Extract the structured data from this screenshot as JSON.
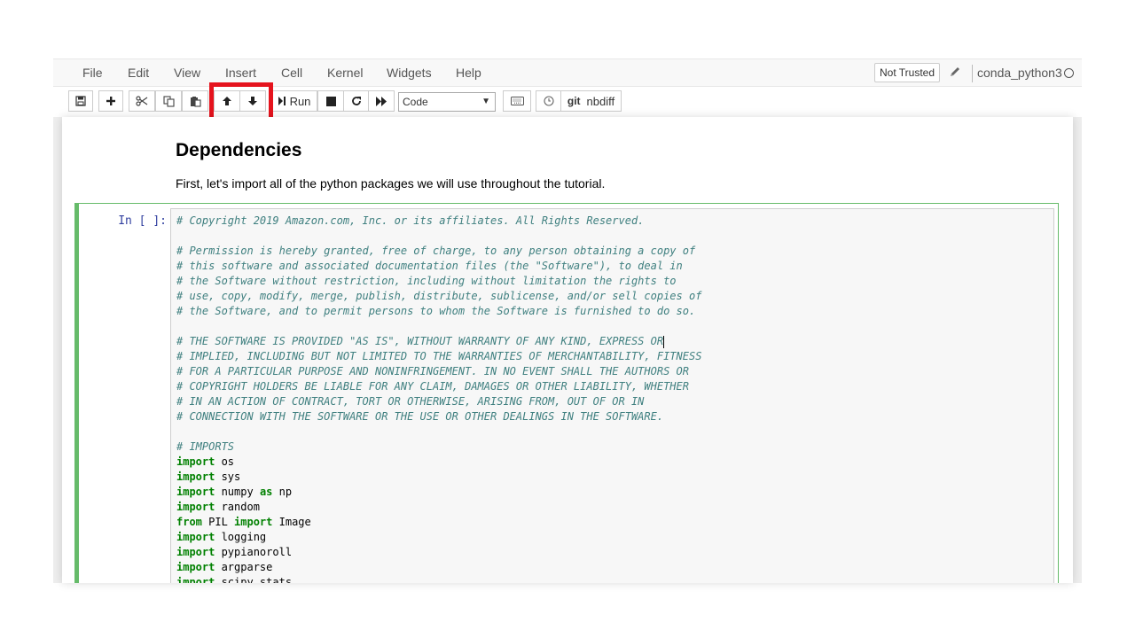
{
  "menu": {
    "items": [
      "File",
      "Edit",
      "View",
      "Insert",
      "Cell",
      "Kernel",
      "Widgets",
      "Help"
    ],
    "trust_status": "Not Trusted",
    "kernel_name": "conda_python3"
  },
  "toolbar": {
    "save_icon": "save-icon",
    "insert_icon": "plus-icon",
    "cut_icon": "scissors-icon",
    "copy_icon": "copy-icon",
    "paste_icon": "paste-icon",
    "move_up_icon": "arrow-up-icon",
    "move_down_icon": "arrow-down-icon",
    "run_label": "Run",
    "interrupt_icon": "stop-icon",
    "restart_icon": "restart-icon",
    "restart_run_icon": "fast-forward-icon",
    "cell_type": "Code",
    "keyboard_icon": "keyboard-icon",
    "clock_icon": "clock-icon",
    "git_label": "git",
    "nbdiff_label": "nbdiff",
    "highlight_color": "#e5131d"
  },
  "markdown": {
    "heading": "Dependencies",
    "intro": "First, let's import all of the python packages we will use throughout the tutorial."
  },
  "code_cell": {
    "prompt": "In [ ]:",
    "border_color": "#66bb6a",
    "lines": [
      [
        {
          "t": "comment",
          "s": "# Copyright 2019 Amazon.com, Inc. or its affiliates. All Rights Reserved."
        }
      ],
      [],
      [
        {
          "t": "comment",
          "s": "# Permission is hereby granted, free of charge, to any person obtaining a copy of"
        }
      ],
      [
        {
          "t": "comment",
          "s": "# this software and associated documentation files (the \"Software\"), to deal in"
        }
      ],
      [
        {
          "t": "comment",
          "s": "# the Software without restriction, including without limitation the rights to"
        }
      ],
      [
        {
          "t": "comment",
          "s": "# use, copy, modify, merge, publish, distribute, sublicense, and/or sell copies of"
        }
      ],
      [
        {
          "t": "comment",
          "s": "# the Software, and to permit persons to whom the Software is furnished to do so."
        }
      ],
      [],
      [
        {
          "t": "comment",
          "s": "# THE SOFTWARE IS PROVIDED \"AS IS\", WITHOUT WARRANTY OF ANY KIND, EXPRESS OR"
        },
        {
          "t": "cursor",
          "s": ""
        }
      ],
      [
        {
          "t": "comment",
          "s": "# IMPLIED, INCLUDING BUT NOT LIMITED TO THE WARRANTIES OF MERCHANTABILITY, FITNESS"
        }
      ],
      [
        {
          "t": "comment",
          "s": "# FOR A PARTICULAR PURPOSE AND NONINFRINGEMENT. IN NO EVENT SHALL THE AUTHORS OR"
        }
      ],
      [
        {
          "t": "comment",
          "s": "# COPYRIGHT HOLDERS BE LIABLE FOR ANY CLAIM, DAMAGES OR OTHER LIABILITY, WHETHER"
        }
      ],
      [
        {
          "t": "comment",
          "s": "# IN AN ACTION OF CONTRACT, TORT OR OTHERWISE, ARISING FROM, OUT OF OR IN"
        }
      ],
      [
        {
          "t": "comment",
          "s": "# CONNECTION WITH THE SOFTWARE OR THE USE OR OTHER DEALINGS IN THE SOFTWARE."
        }
      ],
      [],
      [
        {
          "t": "comment",
          "s": "# IMPORTS"
        }
      ],
      [
        {
          "t": "keyword",
          "s": "import"
        },
        {
          "t": "var",
          "s": " os"
        }
      ],
      [
        {
          "t": "keyword",
          "s": "import"
        },
        {
          "t": "var",
          "s": " sys"
        }
      ],
      [
        {
          "t": "keyword",
          "s": "import"
        },
        {
          "t": "var",
          "s": " numpy "
        },
        {
          "t": "keyword",
          "s": "as"
        },
        {
          "t": "var",
          "s": " np"
        }
      ],
      [
        {
          "t": "keyword",
          "s": "import"
        },
        {
          "t": "var",
          "s": " random"
        }
      ],
      [
        {
          "t": "keyword",
          "s": "from"
        },
        {
          "t": "var",
          "s": " PIL "
        },
        {
          "t": "keyword",
          "s": "import"
        },
        {
          "t": "var",
          "s": " Image"
        }
      ],
      [
        {
          "t": "keyword",
          "s": "import"
        },
        {
          "t": "var",
          "s": " logging"
        }
      ],
      [
        {
          "t": "keyword",
          "s": "import"
        },
        {
          "t": "var",
          "s": " pypianoroll"
        }
      ],
      [
        {
          "t": "keyword",
          "s": "import"
        },
        {
          "t": "var",
          "s": " argparse"
        }
      ],
      [
        {
          "t": "keyword",
          "s": "import"
        },
        {
          "t": "var",
          "s": " scipy.stats"
        }
      ]
    ]
  }
}
